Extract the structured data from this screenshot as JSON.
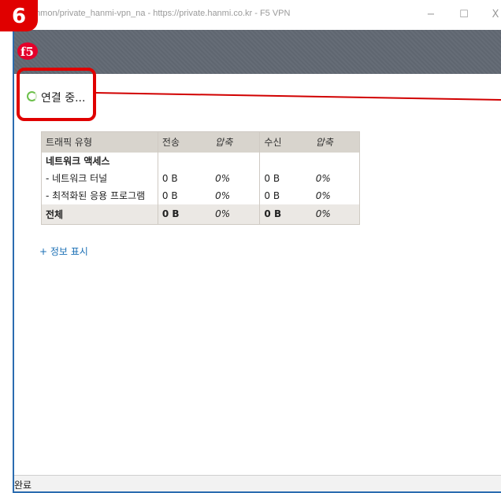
{
  "window": {
    "title": "mmon/private_hanmi-vpn_na - https://private.hanmi.co.kr - F5 VPN",
    "minimize_glyph": "−",
    "maximize_glyph": "☐",
    "close_glyph": "X"
  },
  "banner": {
    "logo_text": "f5",
    "logo_color": "#e4002b",
    "background": "#5f6670"
  },
  "step_badge": {
    "label": "6",
    "color": "#e00000"
  },
  "status": {
    "text": "연결 중...",
    "spinner_color": "#6cc04a"
  },
  "table": {
    "headers": [
      "트래픽 유형",
      "전송",
      "압축",
      "수신",
      "압축"
    ],
    "rows": [
      {
        "type": "네트워크 액세스",
        "sent": "",
        "sent_comp": "",
        "recv": "",
        "recv_comp": ""
      },
      {
        "type": " - 네트워크 터널",
        "sent": "0 B",
        "sent_comp": "0%",
        "recv": "0 B",
        "recv_comp": "0%"
      },
      {
        "type": " - 최적화된 응용 프로그램",
        "sent": "0 B",
        "sent_comp": "0%",
        "recv": "0 B",
        "recv_comp": "0%"
      }
    ],
    "total": {
      "type": "전체",
      "sent": "0 B",
      "sent_comp": "0%",
      "recv": "0 B",
      "recv_comp": "0%"
    }
  },
  "details_link": "+ 정보 표시",
  "statusbar": {
    "text": "완료"
  }
}
